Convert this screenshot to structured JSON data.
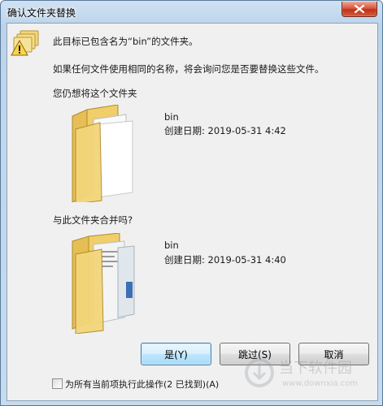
{
  "window": {
    "title": "确认文件夹替换"
  },
  "dialog": {
    "message_line1": "此目标已包含名为“bin”的文件夹。",
    "message_line2": "如果任何文件使用相同的名称，将会询问您是否要替换这些文件。",
    "prompt_keep": "您仍想将这个文件夹",
    "prompt_merge": "与此文件夹合并吗?",
    "target_folder": {
      "name": "bin",
      "date": "创建日期: 2019-05-31   4:42"
    },
    "source_folder": {
      "name": "bin",
      "date": "创建日期: 2019-05-31   4:40"
    }
  },
  "buttons": {
    "yes": "是(Y)",
    "skip": "跳过(S)",
    "cancel": "取消"
  },
  "checkbox": {
    "label": "为所有当前项执行此操作(2 已找到)(A)",
    "checked": false
  },
  "watermark": {
    "text_cn": "当下软件园",
    "text_url": "www.downxia.com"
  },
  "colors": {
    "accent": "#3c7fb1",
    "close": "#c1301a",
    "folder": "#e8c86a"
  },
  "icons": {
    "close": "close-icon",
    "warning": "warning-icon",
    "folder": "folder-icon"
  }
}
